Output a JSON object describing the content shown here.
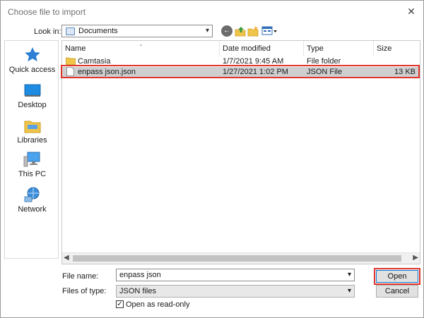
{
  "window": {
    "title": "Choose file to import",
    "close_glyph": "✕"
  },
  "toolbar": {
    "lookin_label": "Look in:",
    "lookin_value": "Documents",
    "back_glyph": "←",
    "icons": [
      "back-icon",
      "up-folder-icon",
      "new-folder-icon",
      "views-menu-icon"
    ]
  },
  "places": [
    {
      "label": "Quick access",
      "icon": "star-icon"
    },
    {
      "label": "Desktop",
      "icon": "desktop-icon"
    },
    {
      "label": "Libraries",
      "icon": "libraries-icon"
    },
    {
      "label": "This PC",
      "icon": "this-pc-icon"
    },
    {
      "label": "Network",
      "icon": "network-icon"
    }
  ],
  "columns": {
    "name": "Name",
    "date": "Date modified",
    "type": "Type",
    "size": "Size"
  },
  "files": [
    {
      "name": "Camtasia",
      "date": "1/7/2021 9:45 AM",
      "type": "File folder",
      "size": "",
      "icon": "folder-icon"
    },
    {
      "name": "enpass json.json",
      "date": "1/27/2021 1:02 PM",
      "type": "JSON File",
      "size": "13 KB",
      "icon": "file-icon",
      "selected": true
    }
  ],
  "form": {
    "filename_label": "File name:",
    "filename_value": "enpass json",
    "filetype_label": "Files of type:",
    "filetype_value": "JSON files",
    "readonly_label": "Open as read-only",
    "readonly_checked": true,
    "check_glyph": "✓"
  },
  "buttons": {
    "open": "Open",
    "cancel": "Cancel"
  },
  "colors": {
    "highlight": "#e0352b",
    "selection": "#cfcfcf",
    "accent": "#0078d7"
  }
}
